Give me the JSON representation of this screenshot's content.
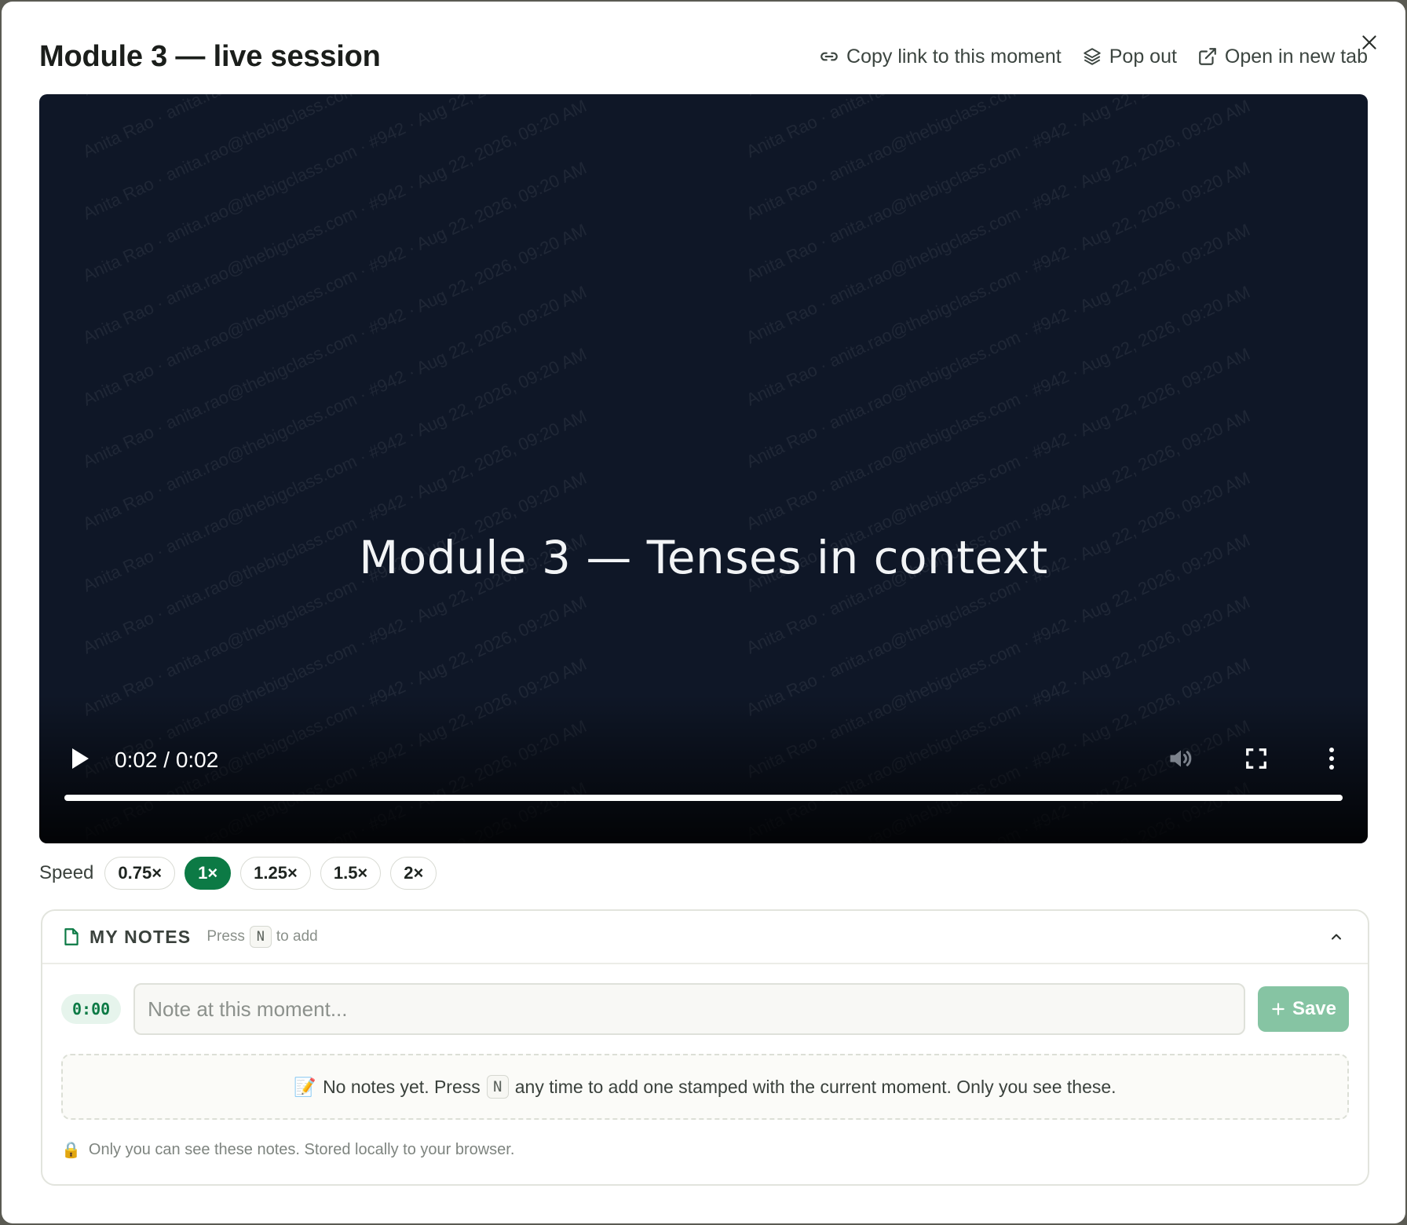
{
  "modal": {
    "title": "Module 3 — live session",
    "actions": {
      "copy_link": "Copy link to this moment",
      "pop_out": "Pop out",
      "open_new_tab": "Open in new tab"
    }
  },
  "video": {
    "slide_title": "Module 3 — Tenses in context",
    "watermark": "Anita Rao · anita.rao@thebigclass.com · #942 · Aug 22, 2026, 09:20 AM",
    "time_display": "0:02 / 0:02",
    "progress_fraction": 1.0
  },
  "speed": {
    "label": "Speed",
    "options": [
      "0.75×",
      "1×",
      "1.25×",
      "1.5×",
      "2×"
    ],
    "selected": "1×"
  },
  "notes": {
    "title": "MY NOTES",
    "hint_prefix": "Press",
    "hint_key": "N",
    "hint_suffix": "to add",
    "timestamp": "0:00",
    "input_placeholder": "Note at this moment...",
    "save_label": "Save",
    "empty_emoji": "📝",
    "empty_prefix": "No notes yet. Press",
    "empty_key": "N",
    "empty_suffix": "any time to add one stamped with the current moment. Only you see these.",
    "privacy_icon": "🔒",
    "privacy_text": "Only you can see these notes. Stored locally to your browser."
  },
  "colors": {
    "accent": "#0c7a45",
    "save_disabled": "#86c4a3",
    "video_bg": "#0f1727"
  }
}
